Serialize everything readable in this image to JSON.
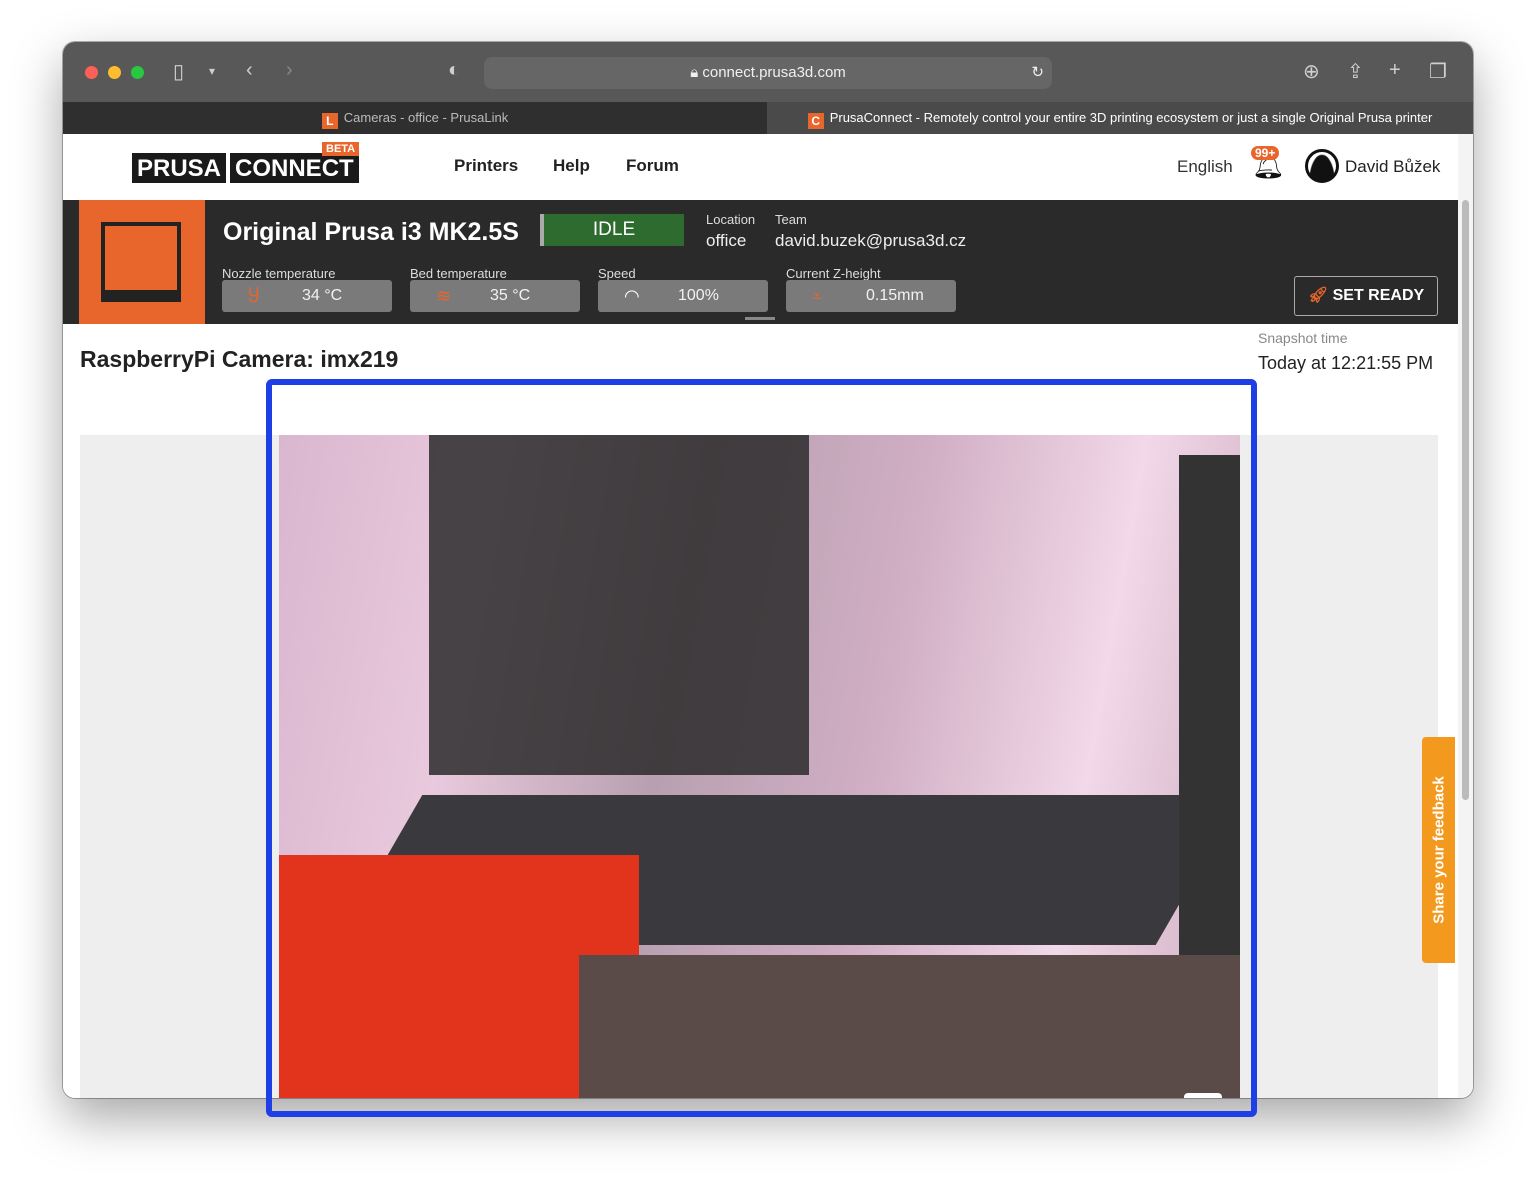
{
  "browser": {
    "url": "connect.prusa3d.com",
    "tabs": [
      {
        "label": "Cameras - office - PrusaLink",
        "favicon": "L"
      },
      {
        "label": "PrusaConnect - Remotely control your entire 3D printing ecosystem or just a single Original Prusa printer",
        "favicon": "C"
      }
    ]
  },
  "header": {
    "logo": [
      "PRUSA",
      "CONNECT"
    ],
    "beta": "BETA",
    "nav": [
      "Printers",
      "Help",
      "Forum"
    ],
    "language": "English",
    "notifications": "99+",
    "user": "David Bůžek"
  },
  "printer": {
    "name": "Original Prusa i3 MK2.5S",
    "state": "IDLE",
    "location_label": "Location",
    "location": "office",
    "team_label": "Team",
    "team": "david.buzek@prusa3d.cz",
    "stats": [
      {
        "label": "Nozzle temperature",
        "value": "34 °C",
        "icon": "nozzle-icon"
      },
      {
        "label": "Bed temperature",
        "value": "35 °C",
        "icon": "bed-heat-icon"
      },
      {
        "label": "Speed",
        "value": "100%",
        "icon": "speedometer-icon"
      },
      {
        "label": "Current Z-height",
        "value": "0.15mm",
        "icon": "z-height-icon"
      }
    ],
    "set_ready": "SET READY"
  },
  "camera": {
    "title": "RaspberryPi Camera: imx219",
    "snapshot_label": "Snapshot time",
    "snapshot_time": "Today at 12:21:55 PM"
  },
  "feedback": "Share your feedback",
  "colors": {
    "accent": "#e8662c",
    "idle": "#2e6b2e",
    "highlight": "#1f3fe6"
  }
}
